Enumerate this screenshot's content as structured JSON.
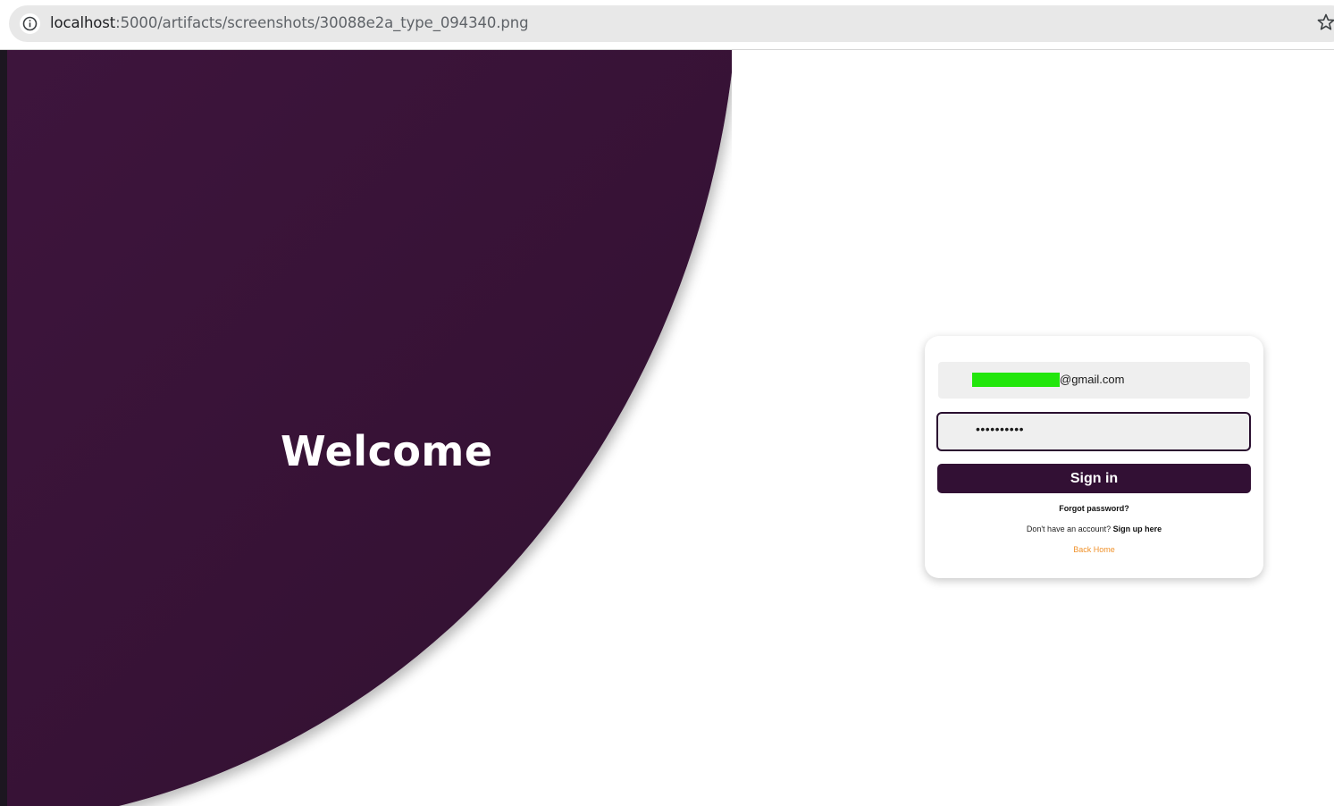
{
  "browser": {
    "url_host": "localhost",
    "url_rest": ":5000/artifacts/screenshots/30088e2a_type_094340.png",
    "info_icon": "info-circle-icon",
    "star_icon": "star-outline-icon"
  },
  "hero": {
    "title": "Welcome",
    "color": "#40163f"
  },
  "login": {
    "email_suffix": "@gmail.com",
    "password_masked": "••••••••••",
    "signin_label": "Sign in",
    "forgot_label": "Forgot password?",
    "signup_prompt": "Don't have an account?",
    "signup_link": "Sign up here",
    "back_home_label": "Back Home",
    "button_color": "#321034",
    "link_accent_color": "#f0922c",
    "redaction_color": "#22e60c"
  }
}
